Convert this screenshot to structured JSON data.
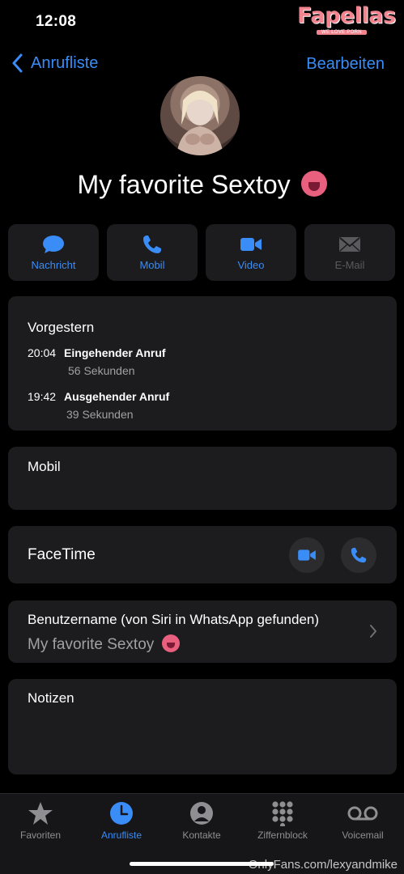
{
  "status": {
    "time": "12:08"
  },
  "watermark": {
    "logo": "Fapellas",
    "tagline": "WE LOVE PORN",
    "credit": "OnlyFans.com/lexyandmike"
  },
  "nav": {
    "back_label": "Anrufliste",
    "edit_label": "Bearbeiten"
  },
  "contact": {
    "name": "My favorite Sextoy"
  },
  "actions": [
    {
      "label": "Nachricht",
      "icon": "message-icon"
    },
    {
      "label": "Mobil",
      "icon": "phone-icon"
    },
    {
      "label": "Video",
      "icon": "video-icon"
    },
    {
      "label": "E-Mail",
      "icon": "mail-icon",
      "disabled": true
    }
  ],
  "history": {
    "title": "Vorgestern",
    "entries": [
      {
        "time": "20:04",
        "type": "Eingehender Anruf",
        "duration": "56 Sekunden"
      },
      {
        "time": "19:42",
        "type": "Ausgehender Anruf",
        "duration": "39 Sekunden"
      }
    ]
  },
  "mobil": {
    "label": "Mobil"
  },
  "facetime": {
    "label": "FaceTime"
  },
  "username": {
    "label": "Benutzername (von Siri in WhatsApp gefunden)",
    "value": "My favorite Sextoy"
  },
  "notes": {
    "label": "Notizen"
  },
  "tabs": [
    {
      "label": "Favoriten",
      "icon": "star-icon"
    },
    {
      "label": "Anrufliste",
      "icon": "clock-icon",
      "active": true
    },
    {
      "label": "Kontakte",
      "icon": "person-icon"
    },
    {
      "label": "Ziffernblock",
      "icon": "keypad-icon"
    },
    {
      "label": "Voicemail",
      "icon": "voicemail-icon"
    }
  ],
  "colors": {
    "accent": "#3a8cf6",
    "card": "#1c1c1e",
    "background": "#000000",
    "secondary_text": "#a0a0a5"
  }
}
